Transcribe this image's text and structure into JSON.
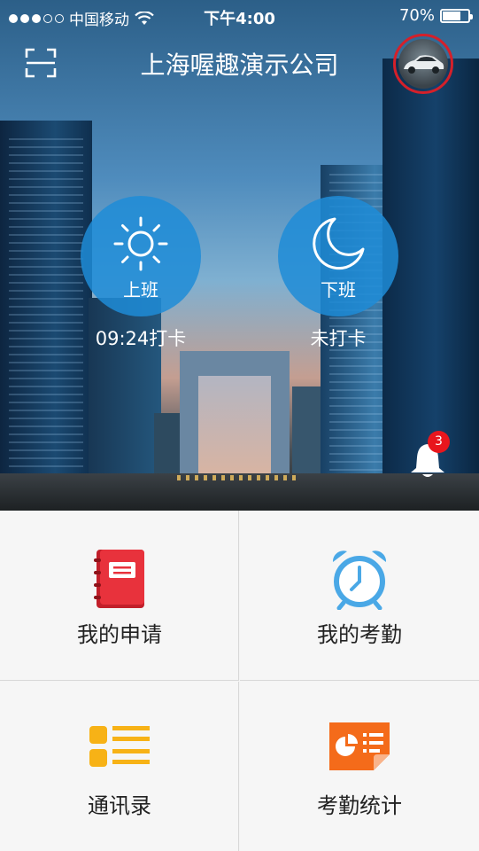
{
  "status_bar": {
    "carrier": "中国移动",
    "time": "下午4:00",
    "battery_percent": "70%",
    "battery_level": 0.7
  },
  "header": {
    "title": "上海喔趣演示公司",
    "scan_icon": "scan-icon",
    "avatar_icon": "car-avatar"
  },
  "punch": {
    "clock_in": {
      "label": "上班",
      "status": "09:24打卡",
      "icon": "sun-icon"
    },
    "clock_out": {
      "label": "下班",
      "status": "未打卡",
      "icon": "moon-icon"
    }
  },
  "notifications": {
    "count": "3",
    "icon": "bell-icon"
  },
  "menu": [
    {
      "label": "我的申请",
      "icon": "notebook-icon",
      "color": "#e8323c"
    },
    {
      "label": "我的考勤",
      "icon": "alarm-clock-icon",
      "color": "#4aa8e6"
    },
    {
      "label": "通讯录",
      "icon": "list-icon",
      "color": "#f7b216"
    },
    {
      "label": "考勤统计",
      "icon": "report-icon",
      "color": "#f46b1a"
    }
  ],
  "colors": {
    "punch_circle": "#1e8cd7",
    "badge": "#e8161d",
    "avatar_ring": "#d4202a"
  }
}
